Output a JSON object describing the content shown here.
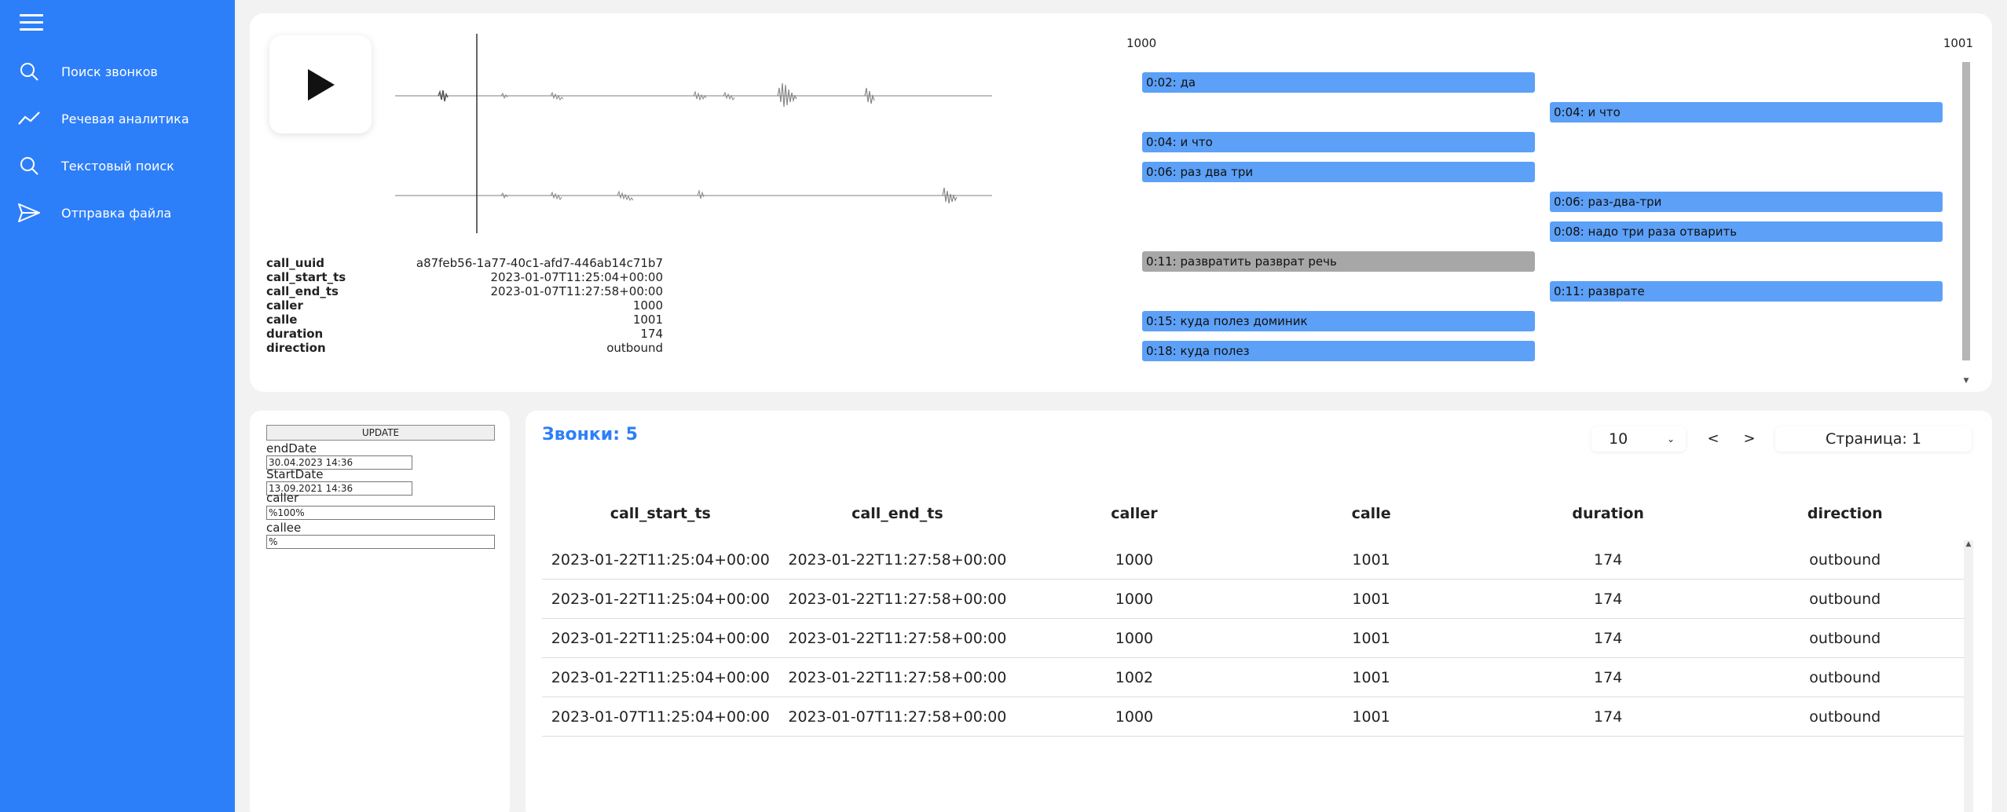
{
  "sidebar": {
    "menu_icon": "hamburger-menu-icon",
    "items": [
      {
        "label": "Поиск звонков",
        "icon": "search-icon"
      },
      {
        "label": "Речевая аналитика",
        "icon": "trend-line-icon"
      },
      {
        "label": "Текстовый поиск",
        "icon": "search-icon"
      },
      {
        "label": "Отправка файла",
        "icon": "send-icon"
      }
    ]
  },
  "player": {
    "play_icon": "play-icon",
    "meta": [
      {
        "key": "call_uuid",
        "value": "a87feb56-1a77-40c1-afd7-446ab14c71b7"
      },
      {
        "key": "call_start_ts",
        "value": "2023-01-07T11:25:04+00:00"
      },
      {
        "key": "call_end_ts",
        "value": "2023-01-07T11:27:58+00:00"
      },
      {
        "key": "caller",
        "value": "1000"
      },
      {
        "key": "calle",
        "value": "1001"
      },
      {
        "key": "duration",
        "value": "174"
      },
      {
        "key": "direction",
        "value": "outbound"
      }
    ]
  },
  "transcript": {
    "party_a": "1000",
    "party_b": "1001",
    "segments": [
      {
        "side": "left",
        "text": "0:02: да",
        "active": false
      },
      {
        "side": "right",
        "text": "0:04: и что",
        "active": false
      },
      {
        "side": "left",
        "text": "0:04: и что",
        "active": false
      },
      {
        "side": "left",
        "text": "0:06: раз два три",
        "active": false
      },
      {
        "side": "right",
        "text": "0:06: раз-два-три",
        "active": false
      },
      {
        "side": "right",
        "text": "0:08: надо три раза отварить",
        "active": false
      },
      {
        "side": "left",
        "text": "0:11: развратить разврат речь",
        "active": true
      },
      {
        "side": "right",
        "text": "0:11: разврате",
        "active": false
      },
      {
        "side": "left",
        "text": "0:15: куда полез доминик",
        "active": false
      },
      {
        "side": "left",
        "text": "0:18: куда полез",
        "active": false
      }
    ]
  },
  "filters": {
    "update_label": "UPDATE",
    "end_date_label": "endDate",
    "end_date_value": "30.04.2023 14:36",
    "start_date_label": "StartDate",
    "start_date_value": "13.09.2021 14:36",
    "caller_label": "caller",
    "caller_value": "%100%",
    "callee_label": "callee",
    "callee_value": "%"
  },
  "calls": {
    "title": "Звонки: 5",
    "per_page": "10",
    "prev_label": "<",
    "next_label": ">",
    "page_label": "Страница: 1",
    "columns": [
      "call_start_ts",
      "call_end_ts",
      "caller",
      "calle",
      "duration",
      "direction"
    ],
    "rows": [
      [
        "2023-01-22T11:25:04+00:00",
        "2023-01-22T11:27:58+00:00",
        "1000",
        "1001",
        "174",
        "outbound"
      ],
      [
        "2023-01-22T11:25:04+00:00",
        "2023-01-22T11:27:58+00:00",
        "1000",
        "1001",
        "174",
        "outbound"
      ],
      [
        "2023-01-22T11:25:04+00:00",
        "2023-01-22T11:27:58+00:00",
        "1000",
        "1001",
        "174",
        "outbound"
      ],
      [
        "2023-01-22T11:25:04+00:00",
        "2023-01-22T11:27:58+00:00",
        "1002",
        "1001",
        "174",
        "outbound"
      ],
      [
        "2023-01-07T11:25:04+00:00",
        "2023-01-07T11:27:58+00:00",
        "1000",
        "1001",
        "174",
        "outbound"
      ]
    ]
  },
  "colors": {
    "accent": "#2d7ff9",
    "segment": "#5ca0f7",
    "segment_active": "#a7a7a7"
  }
}
